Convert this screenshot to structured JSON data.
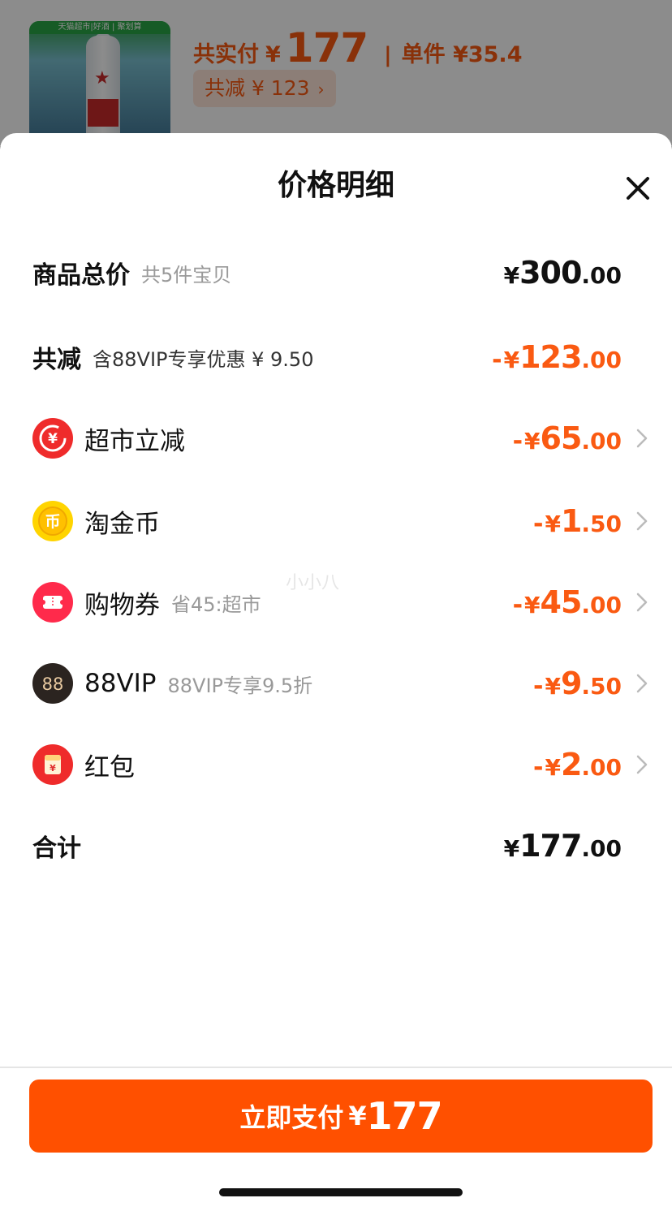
{
  "background": {
    "thumb_banner": "天猫超市|好酒 | 聚划算",
    "price_prefix": "共实付",
    "price_yen": "¥",
    "price_value": "177",
    "separator": "|",
    "unit_price": "单件 ¥35.4",
    "discount_chip": "共减 ¥ 123",
    "chip_chevron": "›"
  },
  "sheet": {
    "title": "价格明细"
  },
  "rows": {
    "total": {
      "label": "商品总价",
      "sub": "共5件宝贝",
      "yen": "¥",
      "int": "300",
      "dec": ".00"
    },
    "reduction": {
      "label": "共减",
      "sub": "含88VIP专享优惠 ¥ 9.50",
      "minus": "-",
      "yen": "¥",
      "int": "123",
      "dec": ".00"
    },
    "items": [
      {
        "label": "超市立减",
        "sub": "",
        "minus": "-",
        "yen": "¥",
        "int": "65",
        "dec": ".00",
        "icon": "supermarket-discount-icon"
      },
      {
        "label": "淘金币",
        "sub": "",
        "minus": "-",
        "yen": "¥",
        "int": "1",
        "dec": ".50",
        "icon": "taojinbi-coin-icon"
      },
      {
        "label": "购物券",
        "sub": "省45:超市",
        "minus": "-",
        "yen": "¥",
        "int": "45",
        "dec": ".00",
        "icon": "coupon-icon"
      },
      {
        "label": "88VIP",
        "sub": "88VIP专享9.5折",
        "minus": "-",
        "yen": "¥",
        "int": "9",
        "dec": ".50",
        "icon": "88vip-icon"
      },
      {
        "label": "红包",
        "sub": "",
        "minus": "-",
        "yen": "¥",
        "int": "2",
        "dec": ".00",
        "icon": "red-packet-icon"
      }
    ],
    "sum": {
      "label": "合计",
      "yen": "¥",
      "int": "177",
      "dec": ".00"
    }
  },
  "watermark": "小小八",
  "pay_button": {
    "label": "立即支付",
    "yen": "¥",
    "amount": "177"
  },
  "colors": {
    "accent": "#ff5000",
    "discount": "#fa5a12",
    "text": "#111111",
    "muted": "#999999"
  }
}
